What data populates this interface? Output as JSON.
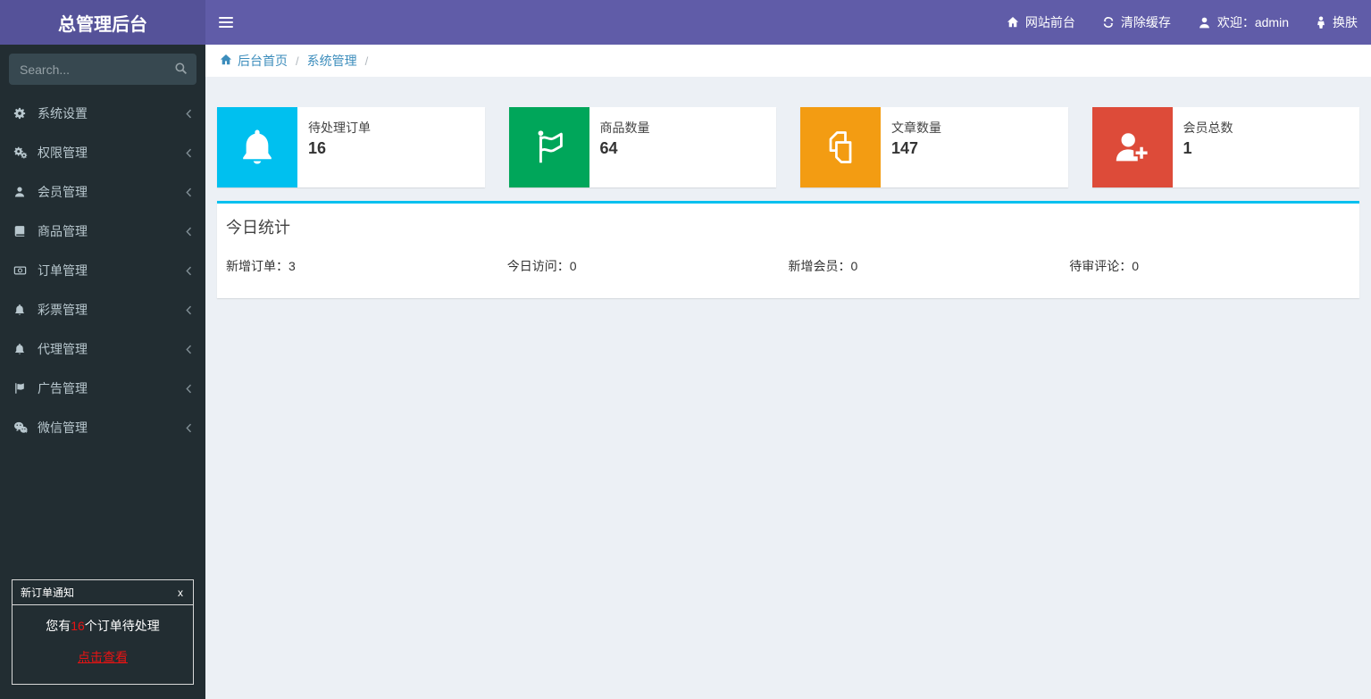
{
  "header": {
    "brand": "总管理后台",
    "nav": [
      {
        "icon": "home-icon",
        "label": "网站前台"
      },
      {
        "icon": "refresh-icon",
        "label": "清除缓存"
      },
      {
        "icon": "user-icon",
        "label": "欢迎：admin"
      },
      {
        "icon": "person-icon",
        "label": "换肤"
      }
    ]
  },
  "sidebar": {
    "search_placeholder": "Search...",
    "items": [
      {
        "icon": "gear-icon",
        "label": "系统设置"
      },
      {
        "icon": "gears-icon",
        "label": "权限管理"
      },
      {
        "icon": "user-icon",
        "label": "会员管理"
      },
      {
        "icon": "book-icon",
        "label": "商品管理"
      },
      {
        "icon": "money-icon",
        "label": "订单管理"
      },
      {
        "icon": "bell-icon",
        "label": "彩票管理"
      },
      {
        "icon": "bell-icon",
        "label": "代理管理"
      },
      {
        "icon": "flag-icon",
        "label": "广告管理"
      },
      {
        "icon": "wechat-icon",
        "label": "微信管理"
      }
    ],
    "notification": {
      "title": "新订单通知",
      "close": "x",
      "message_prefix": "您有",
      "message_count": "16",
      "message_suffix": "个订单待处理",
      "link": "点击查看",
      "accent_color": "#e81313"
    }
  },
  "breadcrumb": {
    "items": [
      "后台首页",
      "系统管理"
    ],
    "separator": "/"
  },
  "stat_cards": [
    {
      "icon": "bell-icon",
      "label": "待处理订单",
      "value": "16",
      "color": "#00c0ef"
    },
    {
      "icon": "flag-icon",
      "label": "商品数量",
      "value": "64",
      "color": "#00a65a"
    },
    {
      "icon": "copy-icon",
      "label": "文章数量",
      "value": "147",
      "color": "#f39c12"
    },
    {
      "icon": "user-plus-icon",
      "label": "会员总数",
      "value": "1",
      "color": "#dd4b39"
    }
  ],
  "today_panel": {
    "title": "今日统计",
    "colon": "：",
    "accent_color": "#00c0ef",
    "stats": [
      {
        "label": "新增订单",
        "value": "3"
      },
      {
        "label": "今日访问",
        "value": "0"
      },
      {
        "label": "新增会员",
        "value": "0"
      },
      {
        "label": "待审评论",
        "value": "0"
      }
    ]
  }
}
